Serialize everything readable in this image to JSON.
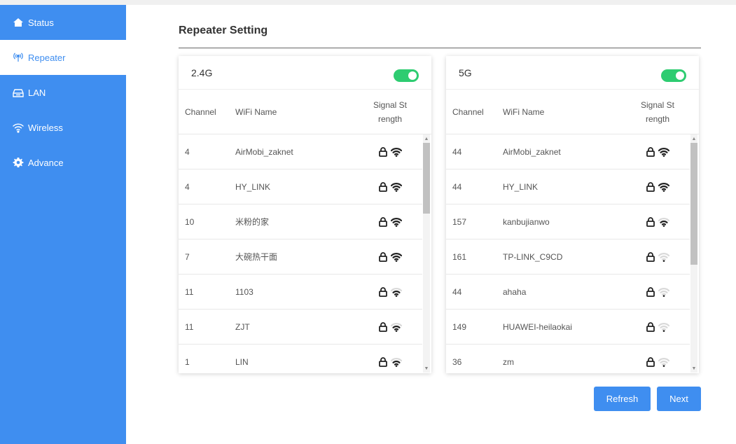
{
  "sidebar": {
    "items": [
      {
        "label": "Status",
        "icon": "home-icon",
        "active": false
      },
      {
        "label": "Repeater",
        "icon": "broadcast-icon",
        "active": true
      },
      {
        "label": "LAN",
        "icon": "lan-icon",
        "active": false
      },
      {
        "label": "Wireless",
        "icon": "wifi-icon",
        "active": false
      },
      {
        "label": "Advance",
        "icon": "gear-icon",
        "active": false
      }
    ]
  },
  "page": {
    "title": "Repeater Setting"
  },
  "columns": {
    "channel": "Channel",
    "wifi_name": "WiFi Name",
    "signal_line1": "Signal St",
    "signal_line2": "rength"
  },
  "bands": [
    {
      "label": "2.4G",
      "enabled": true,
      "scroll_thumb_fraction": 0.32,
      "rows": [
        {
          "channel": "4",
          "name": "AirMobi_zaknet",
          "locked": true,
          "signal": 4
        },
        {
          "channel": "4",
          "name": "HY_LINK",
          "locked": true,
          "signal": 4
        },
        {
          "channel": "10",
          "name": "米粉的家",
          "locked": true,
          "signal": 4
        },
        {
          "channel": "7",
          "name": "大碗热干面",
          "locked": true,
          "signal": 4
        },
        {
          "channel": "11",
          "name": "1103",
          "locked": true,
          "signal": 3
        },
        {
          "channel": "11",
          "name": "ZJT",
          "locked": true,
          "signal": 3
        },
        {
          "channel": "1",
          "name": "LIN",
          "locked": true,
          "signal": 3
        }
      ]
    },
    {
      "label": "5G",
      "enabled": true,
      "scroll_thumb_fraction": 0.55,
      "rows": [
        {
          "channel": "44",
          "name": "AirMobi_zaknet",
          "locked": true,
          "signal": 4
        },
        {
          "channel": "44",
          "name": "HY_LINK",
          "locked": true,
          "signal": 4
        },
        {
          "channel": "157",
          "name": "kanbujianwo",
          "locked": true,
          "signal": 3
        },
        {
          "channel": "161",
          "name": "TP-LINK_C9CD",
          "locked": true,
          "signal": 1
        },
        {
          "channel": "44",
          "name": "ahaha",
          "locked": true,
          "signal": 1
        },
        {
          "channel": "149",
          "name": "HUAWEI-heilaokai",
          "locked": true,
          "signal": 1
        },
        {
          "channel": "36",
          "name": "zm",
          "locked": true,
          "signal": 1
        }
      ]
    }
  ],
  "buttons": {
    "refresh": "Refresh",
    "next": "Next"
  },
  "colors": {
    "accent": "#3f8ef0",
    "toggle_on": "#2ecc71",
    "icon_dark": "#222222",
    "icon_faint": "#d9d9d9"
  }
}
